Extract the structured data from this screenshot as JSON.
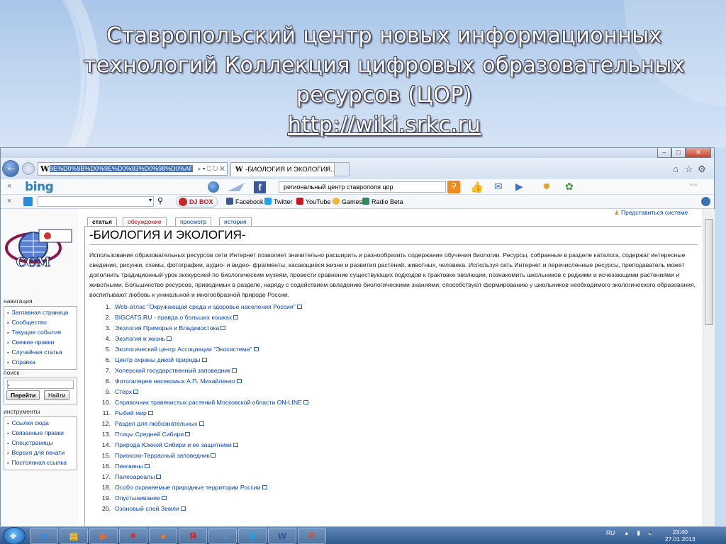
{
  "slide": {
    "title_line1": "Ставропольский центр новых информационных",
    "title_line2": "технологий Коллекция цифровых образовательных",
    "title_line3": "ресурсов (ЦОР)",
    "url": "http://wiki.srkc.ru"
  },
  "browser": {
    "address_text": "9E%D0%9B%D0%9E%D0%93%D0%98%D0%AF",
    "address_controls": "⌕ ▾ ⎕ ↻ ✕",
    "tab_title": "-БИОЛОГИЯ И ЭКОЛОГИЯ...",
    "window_buttons": [
      "–",
      "□",
      "✕"
    ],
    "top_right_icons": [
      "home-icon",
      "star-icon",
      "gear-icon"
    ]
  },
  "bing_bar": {
    "logo": "bing",
    "search_value": "региональный центр ставрополя цор",
    "close_label": "×",
    "more_label": "°°°"
  },
  "favorites_bar": {
    "close_label": "×",
    "djbox_label": "DJ BOX",
    "items": [
      {
        "label": "Facebook",
        "color": "#3b5998"
      },
      {
        "label": "Twitter",
        "color": "#1da1f2"
      },
      {
        "label": "YouTube",
        "color": "#cc181e"
      },
      {
        "label": "Games",
        "color": "#f2b632"
      },
      {
        "label": "Radio Beta",
        "color": "#2e8b57"
      }
    ]
  },
  "wiki": {
    "login": "Представиться системе",
    "tabs": [
      "статья",
      "обсуждение",
      "просмотр",
      "история"
    ],
    "title": "-БИОЛОГИЯ И ЭКОЛОГИЯ-",
    "intro": "Использование образовательных ресурсов сети Интернет позволяет значительно расширить и разнообразить содержание обучения биологии. Ресурсы, собранные в разделе каталога, содержат интересные сведения, рисунки, схемы, фотографии, аудио- и видео- фрагменты, касающиеся жизни и развития растений, животных, человека. Используя сеть Интернет и перечисленные ресурсы, преподаватель может дополнить традиционный урок экскурсией по биологическим музеям, провести сравнение существующих подходов к трактовке эволюции, познакомить школьников с редкими и исчезающими растениями и животными. Большинство ресурсов, приводимых в разделе, наряду с содействием овладению биологическими знаниями, способствуют формированию у школьников необходимого экологического образования, воспитывают любовь к уникальной и многообразной природе России.",
    "logo_text": "ССМ",
    "nav_heading": "навигация",
    "nav_items": [
      "Заглавная страница",
      "Сообщество",
      "Текущие события",
      "Свежие правки",
      "Случайная статья",
      "Справка"
    ],
    "search_heading": "поиск",
    "search_go": "Перейти",
    "search_find": "Найти",
    "tools_heading": "инструменты",
    "tools_items": [
      "Ссылки сюда",
      "Связанные правки",
      "Спецстраницы",
      "Версия для печати",
      "Постоянная ссылка"
    ],
    "resources": [
      "Web-атлас \"Окружающая среда и здоровье населения России\"",
      "BIGCATS.RU - правда о больших кошках",
      "Экология Приморья и Владивостока",
      "Экология и жизнь",
      "Экологический центр Ассоциации \"Экосистема\"",
      "Центр охраны дикой природы",
      "Хоперский государственный заповедник",
      "Фотогалерея насекомых А.П. Михайленко",
      "Стерх",
      "Справочник травянистых растений Московской области ON-LINE",
      "Рыбий мир",
      "Раздел для любознательных",
      "Птицы Средней Сибири",
      "Природа Южной Сибири и ее защитники",
      "Приокско-Террасный заповедник",
      "Пингвины",
      "Палеоареалы",
      "Особо охраняемые природные территории России",
      "Опустынивание",
      "Озоновый слой Земли"
    ],
    "resource_numbers": [
      "1.",
      "2.",
      "3.",
      "4.",
      "5.",
      "6.",
      "7.",
      "8.",
      "9.",
      "10.",
      "11.",
      "12.",
      "13.",
      "14.",
      "15.",
      "16.",
      "17.",
      "18.",
      "19.",
      "20."
    ]
  },
  "taskbar": {
    "lang": "RU",
    "time": "23:40",
    "date": "27.01.2013",
    "apps": [
      "ie-icon",
      "explorer-icon",
      "media-icon",
      "paint-icon",
      "firefox-icon",
      "yandex-icon",
      "volume-app-icon",
      "skype-icon",
      "word-icon",
      "powerpoint-icon"
    ]
  }
}
